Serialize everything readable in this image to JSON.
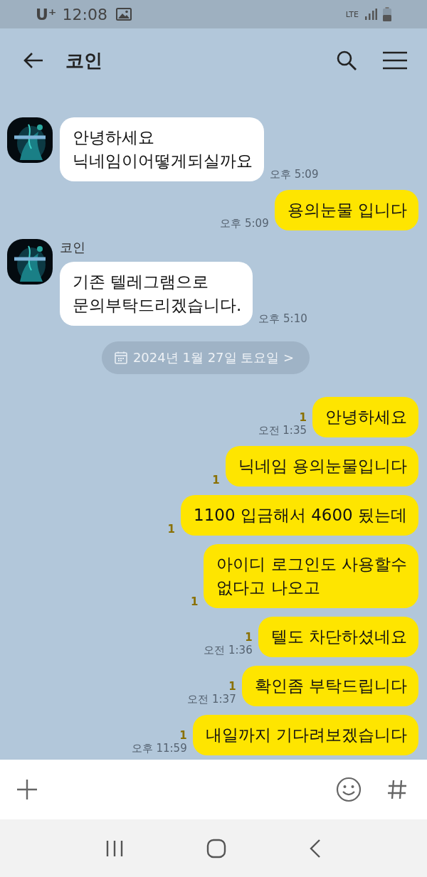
{
  "status_bar": {
    "carrier": "U⁺",
    "time": "12:08",
    "network": "LTE"
  },
  "header": {
    "title": "코인"
  },
  "messages": [
    {
      "kind": "received",
      "avatar": true,
      "text": "안녕하세요\n닉네임이어떻게되실까요",
      "time": "오후 5:09"
    },
    {
      "kind": "sent",
      "text": "용의눈물 입니다",
      "time": "오후 5:09"
    },
    {
      "kind": "received",
      "sender": "코인",
      "avatar": true,
      "text": "기존 텔레그램으로\n문의부탁드리겠습니다.",
      "time": "오후 5:10"
    },
    {
      "kind": "date",
      "text": "2024년 1월 27일 토요일 >"
    },
    {
      "kind": "sent",
      "text": "안녕하세요",
      "time": "오전 1:35",
      "unread": "1"
    },
    {
      "kind": "sent",
      "text": "닉네임 용의눈물입니다",
      "unread": "1"
    },
    {
      "kind": "sent",
      "text": "1100 입금해서 4600 됬는데",
      "unread": "1"
    },
    {
      "kind": "sent",
      "text": "아이디 로그인도 사용할수\n없다고 나오고",
      "unread": "1"
    },
    {
      "kind": "sent",
      "text": "텔도 차단하셨네요",
      "time": "오전 1:36",
      "unread": "1"
    },
    {
      "kind": "sent",
      "text": "확인좀 부탁드립니다",
      "time": "오전 1:37",
      "unread": "1"
    },
    {
      "kind": "sent",
      "text": "내일까지 기다려보겠습니다",
      "time": "오후 11:59",
      "unread": "1"
    }
  ]
}
